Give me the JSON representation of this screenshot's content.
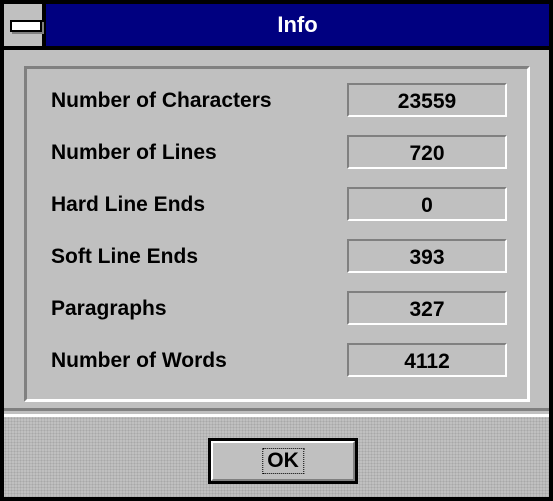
{
  "window": {
    "title": "Info",
    "system_menu_icon": "system-menu-icon"
  },
  "stats": [
    {
      "label": "Number of Characters",
      "value": "23559"
    },
    {
      "label": "Number of Lines",
      "value": "720"
    },
    {
      "label": "Hard Line Ends",
      "value": "0"
    },
    {
      "label": "Soft Line Ends",
      "value": "393"
    },
    {
      "label": "Paragraphs",
      "value": "327"
    },
    {
      "label": "Number of Words",
      "value": "4112"
    }
  ],
  "buttons": {
    "ok_label": "OK"
  },
  "colors": {
    "titlebar": "#000080",
    "face": "#c0c0c0",
    "shadow": "#808080",
    "highlight": "#ffffff"
  }
}
